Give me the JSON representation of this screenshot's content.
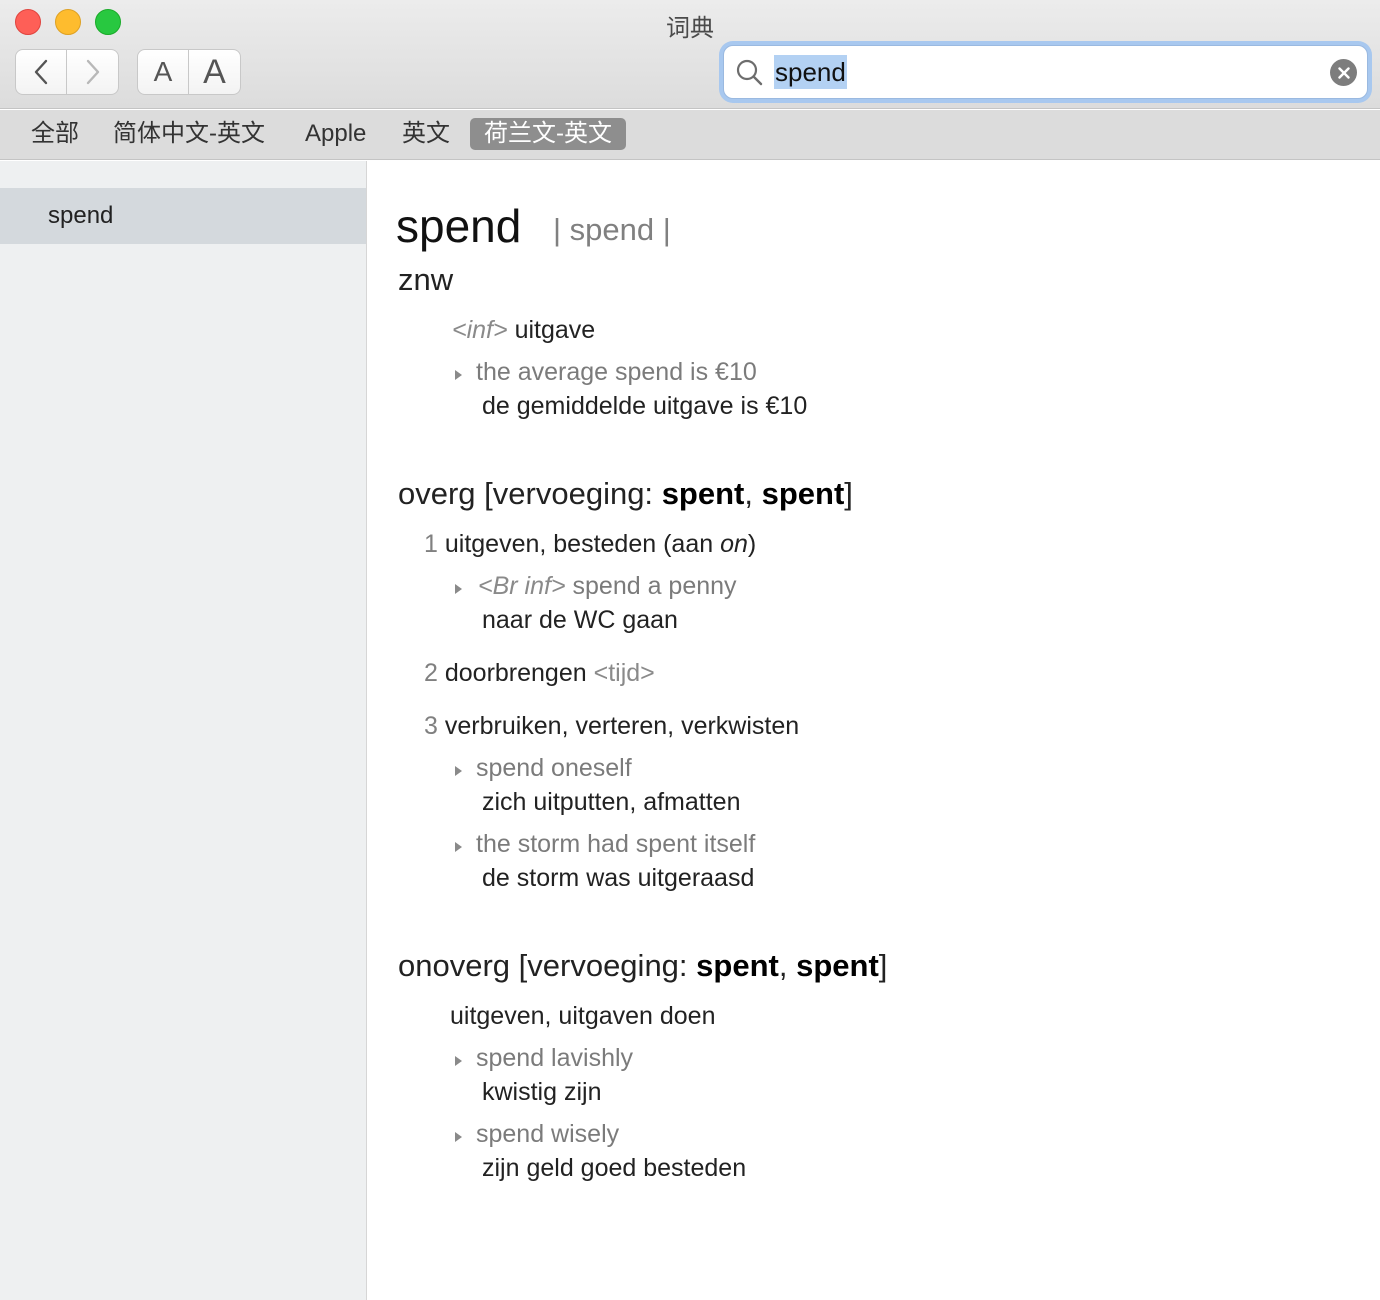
{
  "window": {
    "title": "词典"
  },
  "toolbar": {
    "font_small_label": "A",
    "font_large_label": "A"
  },
  "search": {
    "query": "spend"
  },
  "scopes": [
    "全部",
    "简体中文-英文",
    "Apple",
    "英文",
    "荷兰文-英文"
  ],
  "active_scope": "荷兰文-英文",
  "sidebar": {
    "items": [
      "spend"
    ]
  },
  "entry": {
    "headword": "spend",
    "pronunciation": "| spend |",
    "znw": {
      "pos": "znw",
      "label": "<inf>",
      "definition": "uitgave",
      "examples": [
        {
          "phrase": "the average spend is €10",
          "translation": "de gemiddelde uitgave is €10"
        }
      ]
    },
    "overg": {
      "pos": "overg",
      "conj_label": "vervoeging:",
      "conj1": "spent",
      "conj2": "spent",
      "senses": [
        {
          "num": "1",
          "text": "uitgeven, besteden (aan",
          "italic": "on",
          "close": ")",
          "examples": [
            {
              "label": "<Br inf>",
              "phrase": "spend a penny",
              "translation": "naar de WC gaan"
            }
          ]
        },
        {
          "num": "2",
          "text": "doorbrengen",
          "note": "<tijd>"
        },
        {
          "num": "3",
          "text": "verbruiken, verteren, verkwisten",
          "examples": [
            {
              "phrase": "spend oneself",
              "translation": "zich uitputten, afmatten"
            },
            {
              "phrase": "the storm had spent itself",
              "translation": "de storm was uitgeraasd"
            }
          ]
        }
      ]
    },
    "onoverg": {
      "pos": "onoverg",
      "conj_label": "vervoeging:",
      "conj1": "spent",
      "conj2": "spent",
      "definition": "uitgeven, uitgaven doen",
      "examples": [
        {
          "phrase": "spend lavishly",
          "translation": "kwistig zijn"
        },
        {
          "phrase": "spend wisely",
          "translation": "zijn geld goed besteden"
        }
      ]
    }
  }
}
